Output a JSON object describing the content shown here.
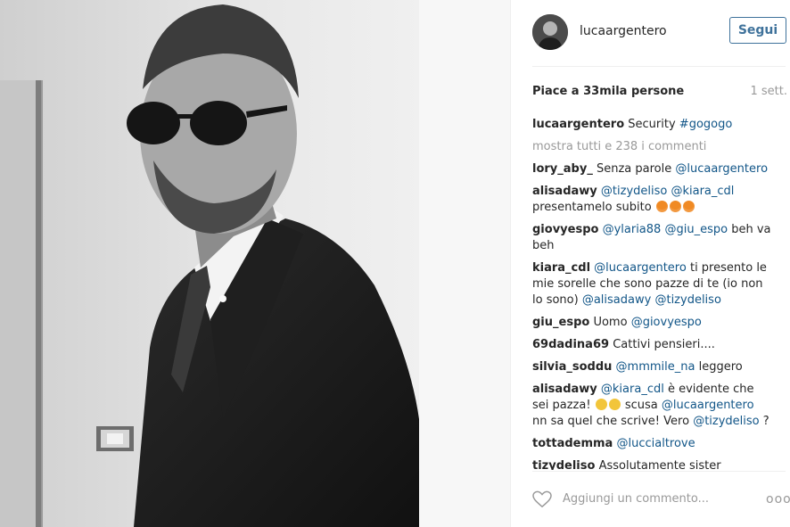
{
  "post": {
    "username": "lucaargentero",
    "follow_label": "Segui",
    "likes_text": "Piace a 33mila persone",
    "time_text": "1 sett.",
    "caption": {
      "user": "lucaargentero",
      "text": "Security",
      "hashtag": "#gogogo"
    },
    "view_all_comments": "mostra tutti e 238 i commenti"
  },
  "comments": [
    {
      "user": "lory_aby_",
      "parts": [
        "Senza parole",
        "@lucaargentero"
      ]
    },
    {
      "user": "alisadawy",
      "parts": [
        "@tizydeliso",
        "@kiara_cdl",
        "presentamelo subito"
      ],
      "emoji": [
        "fox-icon",
        "fox-icon",
        "fox-icon"
      ]
    },
    {
      "user": "giovyespo",
      "parts": [
        "@ylaria88",
        "@giu_espo",
        "beh va beh"
      ]
    },
    {
      "user": "kiara_cdl",
      "parts": [
        "@lucaargentero",
        "ti presento le mie sorelle che sono pazze di te (io non lo sono)",
        "@alisadawy",
        "@tizydeliso"
      ]
    },
    {
      "user": "giu_espo",
      "parts": [
        "Uomo",
        "@giovyespo"
      ]
    },
    {
      "user": "69dadina69",
      "parts": [
        "Cattivi pensieri...."
      ]
    },
    {
      "user": "silvia_soddu",
      "parts": [
        "@mmmile_na",
        "leggero"
      ]
    },
    {
      "user": "alisadawy",
      "parts": [
        "@kiara_cdl",
        "è evidente che sei pazza!",
        "scusa",
        "@lucaargentero",
        "nn sa quel che scrive! Vero",
        "@tizydeliso",
        "?"
      ],
      "emoji": [
        "laughing-icon",
        "laughing-icon"
      ]
    },
    {
      "user": "tottademma",
      "parts": [
        "@luccialtrove"
      ]
    },
    {
      "user": "tizydeliso",
      "parts": [
        "Assolutamente sister"
      ]
    }
  ],
  "footer": {
    "add_comment_placeholder": "Aggiungi un commento...",
    "more_label": "ooo"
  },
  "colors": {
    "link": "#125688",
    "follow_border": "#3f729b",
    "muted": "#999999"
  }
}
